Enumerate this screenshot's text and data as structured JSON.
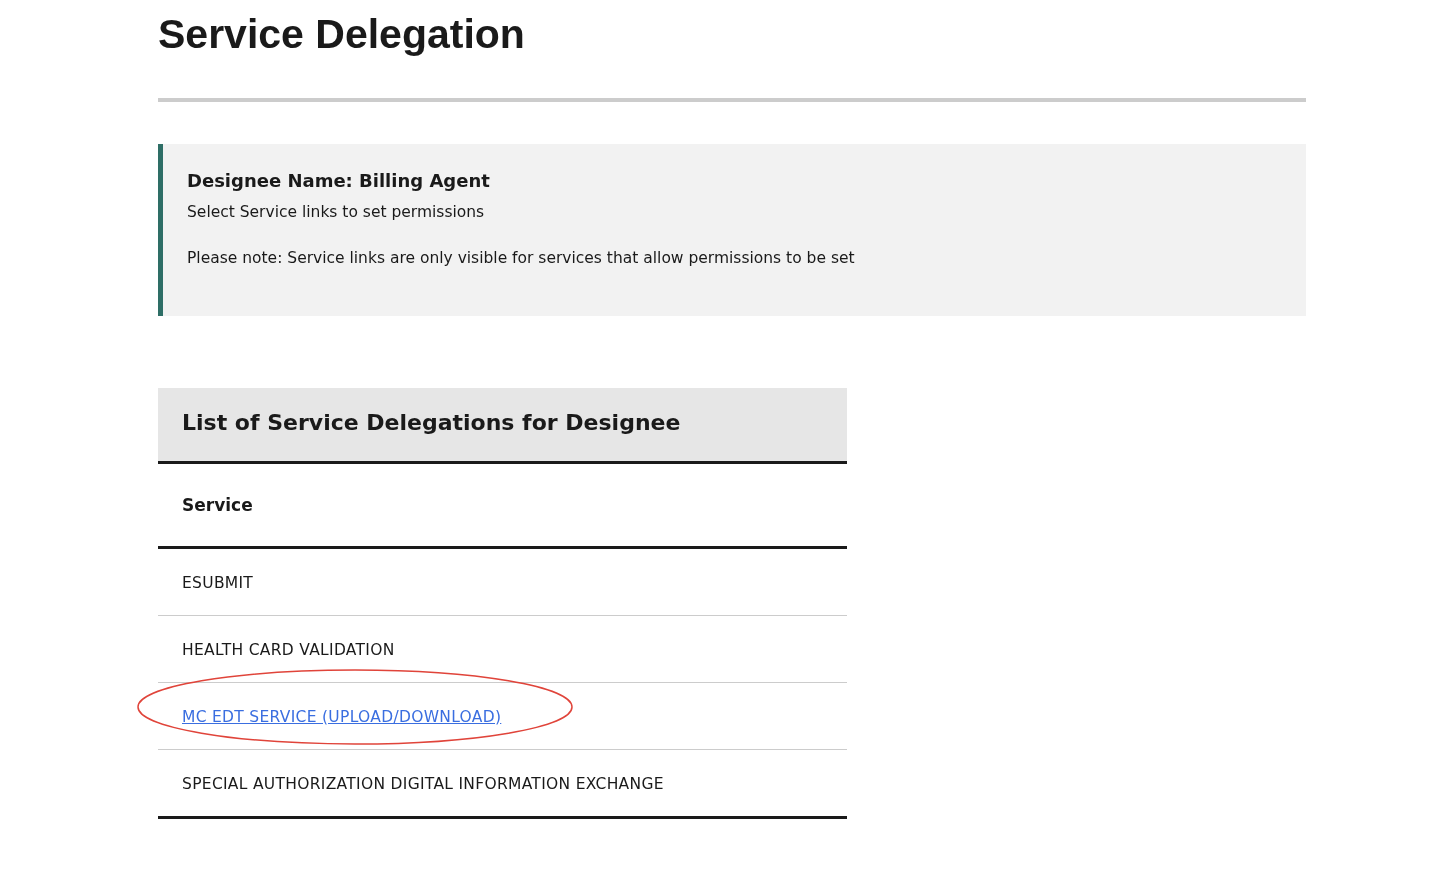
{
  "page_title": "Service Delegation",
  "info": {
    "heading": "Designee Name: Billing Agent",
    "lines": [
      "Select Service links to set permissions",
      "Please note: Service links are only visible for services that allow permissions to be set"
    ]
  },
  "table": {
    "caption": "List of Service Delegations for Designee",
    "columns": [
      "Service"
    ],
    "rows": [
      {
        "service": "ESUBMIT",
        "kind": "text",
        "circled": false
      },
      {
        "service": "HEALTH CARD VALIDATION",
        "kind": "text",
        "circled": false
      },
      {
        "service": "MC EDT SERVICE (UPLOAD/DOWNLOAD)",
        "kind": "link",
        "circled": true
      },
      {
        "service": "SPECIAL AUTHORIZATION DIGITAL INFORMATION EXCHANGE",
        "kind": "text",
        "circled": false
      }
    ]
  }
}
